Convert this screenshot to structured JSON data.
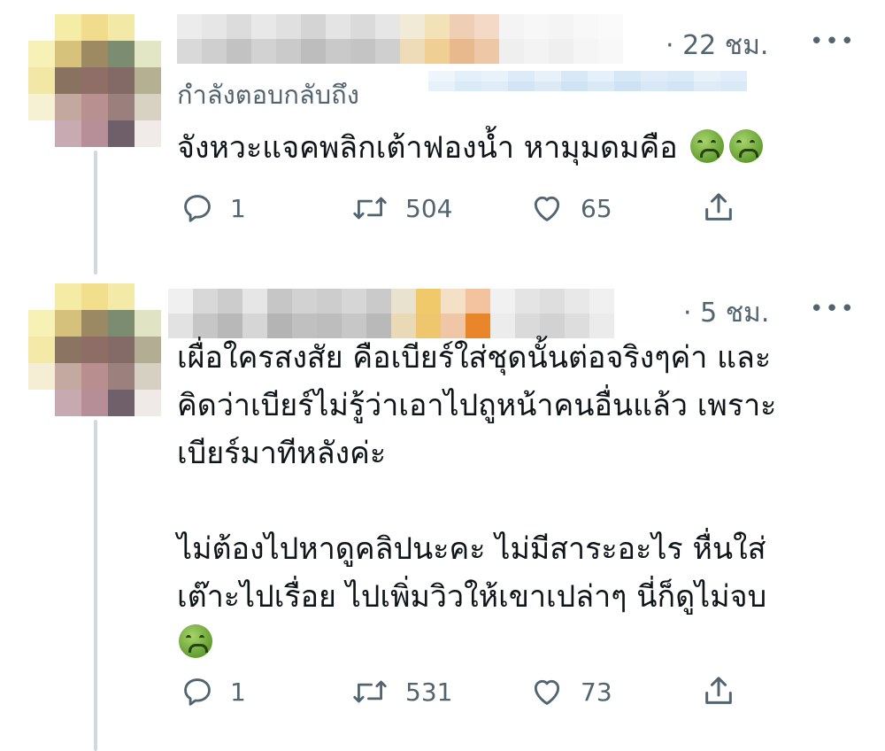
{
  "tweets": [
    {
      "time": "· 22 ชม.",
      "more": "•••",
      "replying_label": "กำลังตอบกลับถึง",
      "text_lines": [
        "จังหวะแจคพลิกเต้าฟองน้ำ หามุมดมคือ"
      ],
      "reply_count": "1",
      "retweet_count": "504",
      "like_count": "65"
    },
    {
      "time": "· 5 ชม.",
      "more": "•••",
      "text_lines": [
        "เผื่อใครสงสัย คือเบียร์ใส่ชุดนั้นต่อจริงๆค่า และ",
        "คิดว่าเบียร์ไม่รู้ว่าเอาไปถูหน้าคนอื่นแล้ว  เพราะ",
        "เบียร์มาทีหลังค่ะ",
        "ไม่ต้องไปหาดูคลิปนะคะ ไม่มีสาระอะไร หื่นใส่",
        "เต๊าะไปเรื่อย ไปเพิ่มวิวให้เขาเปล่าๆ นี่ก็ดูไม่จบ"
      ],
      "reply_count": "1",
      "retweet_count": "531",
      "like_count": "73"
    }
  ],
  "icons": {
    "reply": "reply-icon",
    "retweet": "retweet-icon",
    "like": "heart-icon",
    "share": "share-icon",
    "emoji": "nauseated-face-emoji"
  },
  "colors": {
    "text": "#0f1419",
    "secondary": "#536471",
    "thread_line": "#cfd9de",
    "link_highlight": "#d6e8f5"
  }
}
